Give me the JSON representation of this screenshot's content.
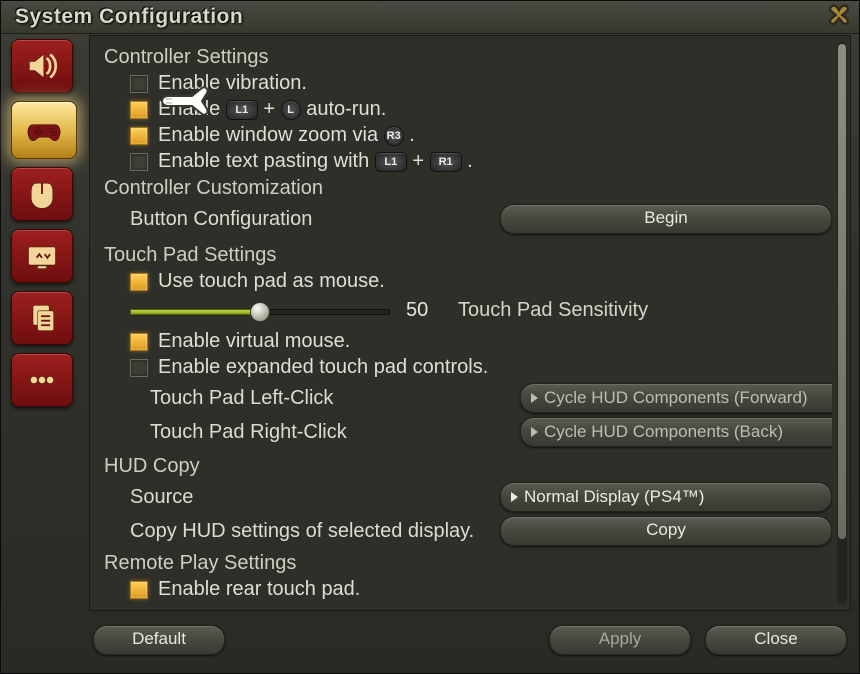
{
  "window": {
    "title": "System Configuration"
  },
  "tabs": [
    {
      "name": "sound",
      "active": false
    },
    {
      "name": "controller",
      "active": true
    },
    {
      "name": "mouse",
      "active": false
    },
    {
      "name": "display",
      "active": false
    },
    {
      "name": "clipboard",
      "active": false
    },
    {
      "name": "other",
      "active": false
    }
  ],
  "sections": {
    "controller_settings": {
      "title": "Controller Settings",
      "vibration": {
        "checked": false,
        "label": "Enable vibration."
      },
      "autorun": {
        "checked": true,
        "pre": "Enable ",
        "key1": "L1",
        "plus": "+",
        "key2": "L",
        "post": " auto-run."
      },
      "windowzoom": {
        "checked": true,
        "pre": "Enable window zoom via ",
        "key": "R3",
        "post": " ."
      },
      "textpaste": {
        "checked": false,
        "pre": "Enable text pasting with ",
        "key1": "L1",
        "plus": " + ",
        "key2": "R1",
        "post": " ."
      }
    },
    "controller_custom": {
      "title": "Controller Customization",
      "button_config_label": "Button Configuration",
      "begin_button": "Begin"
    },
    "touchpad": {
      "title": "Touch Pad Settings",
      "use_as_mouse": {
        "checked": true,
        "label": "Use touch pad as mouse."
      },
      "sensitivity": {
        "value": 50,
        "min": 0,
        "max": 100,
        "label": "Touch Pad Sensitivity"
      },
      "virtual_mouse": {
        "checked": true,
        "label": "Enable virtual mouse."
      },
      "expanded_ctrls": {
        "checked": false,
        "label": "Enable expanded touch pad controls."
      },
      "left_click": {
        "label": "Touch Pad Left-Click",
        "value": "Cycle HUD Components (Forward)"
      },
      "right_click": {
        "label": "Touch Pad Right-Click",
        "value": "Cycle HUD Components (Back)"
      }
    },
    "hud_copy": {
      "title": "HUD Copy",
      "source_label": "Source",
      "source_value": "Normal Display (PS4™)",
      "copy_desc": "Copy HUD settings of selected display.",
      "copy_button": "Copy"
    },
    "remote_play": {
      "title": "Remote Play Settings",
      "rear_touch": {
        "checked": true,
        "label": "Enable rear touch pad."
      }
    }
  },
  "footer": {
    "default": "Default",
    "apply": "Apply",
    "close": "Close"
  }
}
